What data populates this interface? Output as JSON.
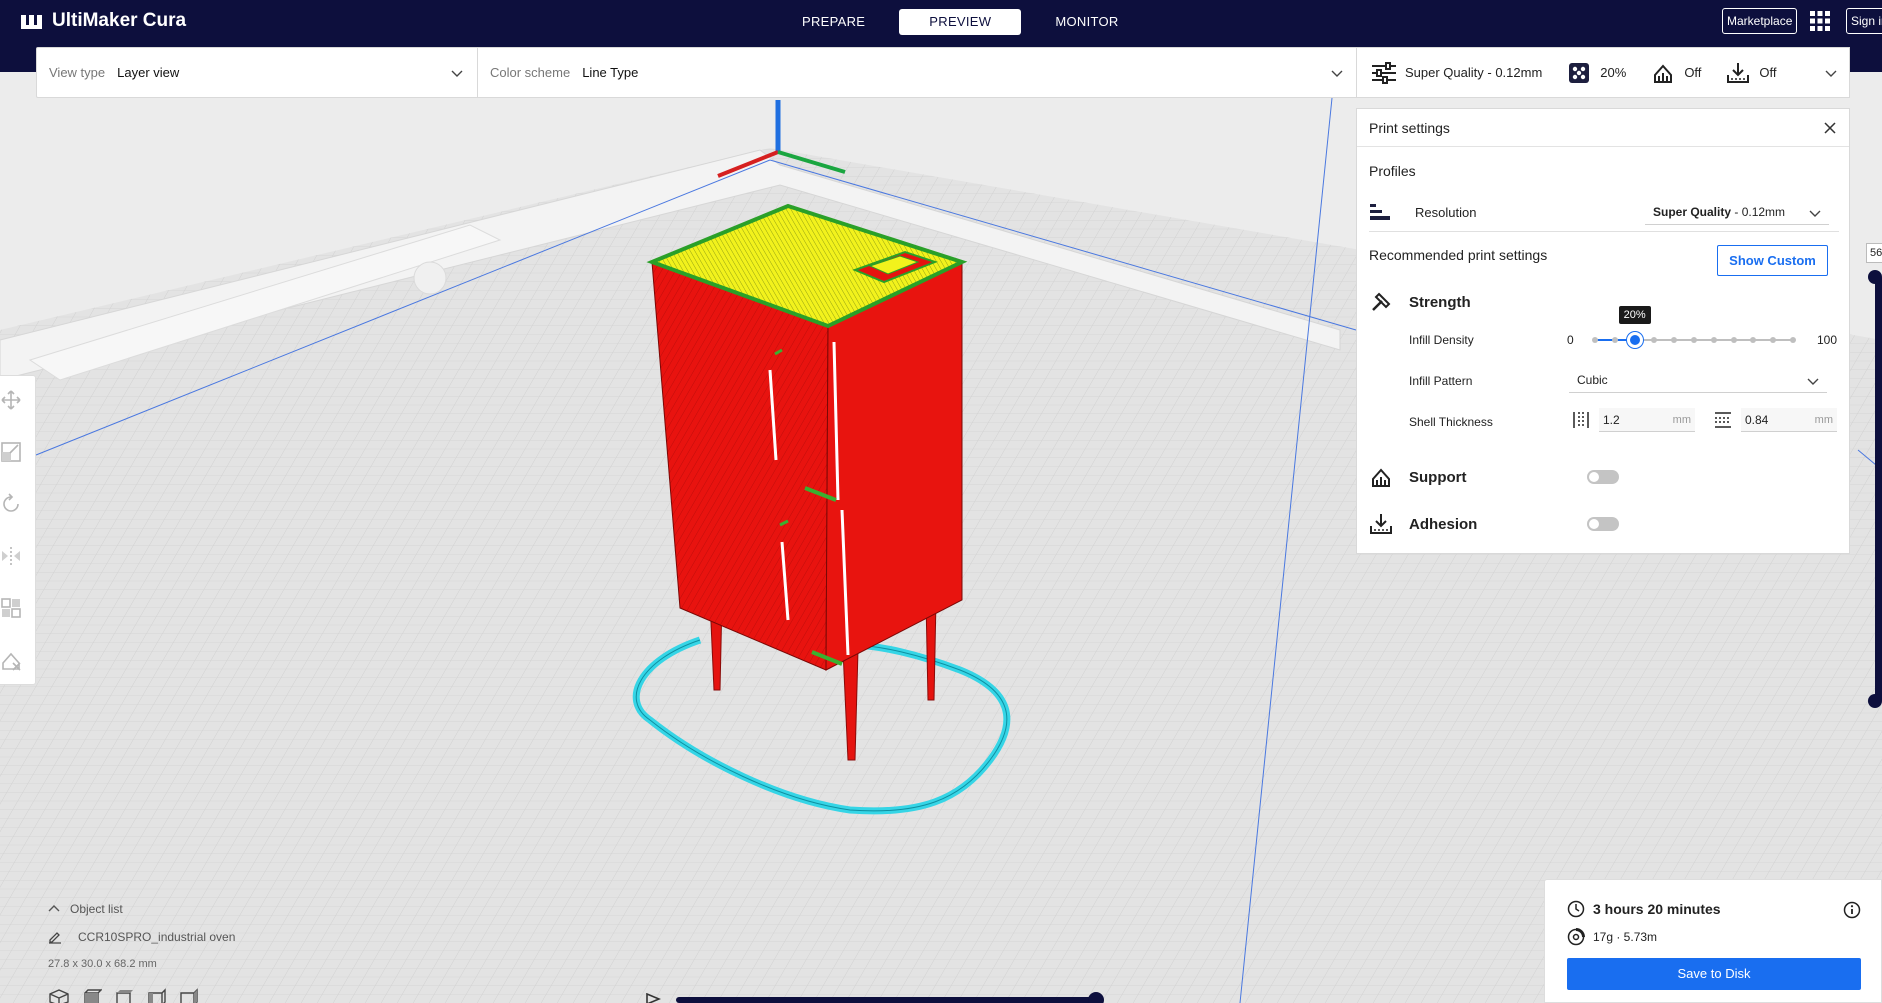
{
  "app": {
    "title": "UltiMaker Cura"
  },
  "header": {
    "stages": [
      {
        "label": "PREPARE"
      },
      {
        "label": "PREVIEW"
      },
      {
        "label": "MONITOR"
      }
    ],
    "active_stage": "PREVIEW",
    "marketplace_label": "Marketplace",
    "signin_label": "Sign in"
  },
  "view_bar": {
    "view_type_label": "View type",
    "view_type_value": "Layer view",
    "color_scheme_label": "Color scheme",
    "color_scheme_value": "Line Type"
  },
  "print_setup": {
    "profile": "Super Quality - 0.12mm",
    "infill": "20%",
    "support": "Off",
    "adhesion": "Off"
  },
  "print_settings": {
    "title": "Print settings",
    "profiles_label": "Profiles",
    "resolution_label": "Resolution",
    "resolution_value_bold": "Super Quality",
    "resolution_value_rest": " - 0.12mm",
    "recommended_label": "Recommended print settings",
    "show_custom_label": "Show Custom",
    "strength_label": "Strength",
    "infill_density_label": "Infill Density",
    "infill_density_min": "0",
    "infill_density_max": "100",
    "infill_density_value": 20,
    "infill_density_tip": "20%",
    "infill_pattern_label": "Infill Pattern",
    "infill_pattern_value": "Cubic",
    "shell_thickness_label": "Shell Thickness",
    "wall_thickness": "1.2",
    "top_bottom_thickness": "0.84",
    "unit": "mm",
    "support_label": "Support",
    "support_enabled": false,
    "adhesion_label": "Adhesion",
    "adhesion_enabled": false
  },
  "layer_slider": {
    "current_layer": "56"
  },
  "object_list": {
    "toggle_label": "Object list",
    "object_name": "CCR10SPRO_industrial oven",
    "dimensions": "27.8 x 30.0 x 68.2 mm"
  },
  "action_panel": {
    "print_time": "3 hours 20 minutes",
    "material": "17g · 5.73m",
    "save_label": "Save to Disk"
  },
  "colors": {
    "header_bg": "#0d0f3d",
    "accent": "#196ef0",
    "wall_red": "#e5130f",
    "top_yellow": "#f5f51e",
    "skirt_cyan": "#35d5e6"
  }
}
